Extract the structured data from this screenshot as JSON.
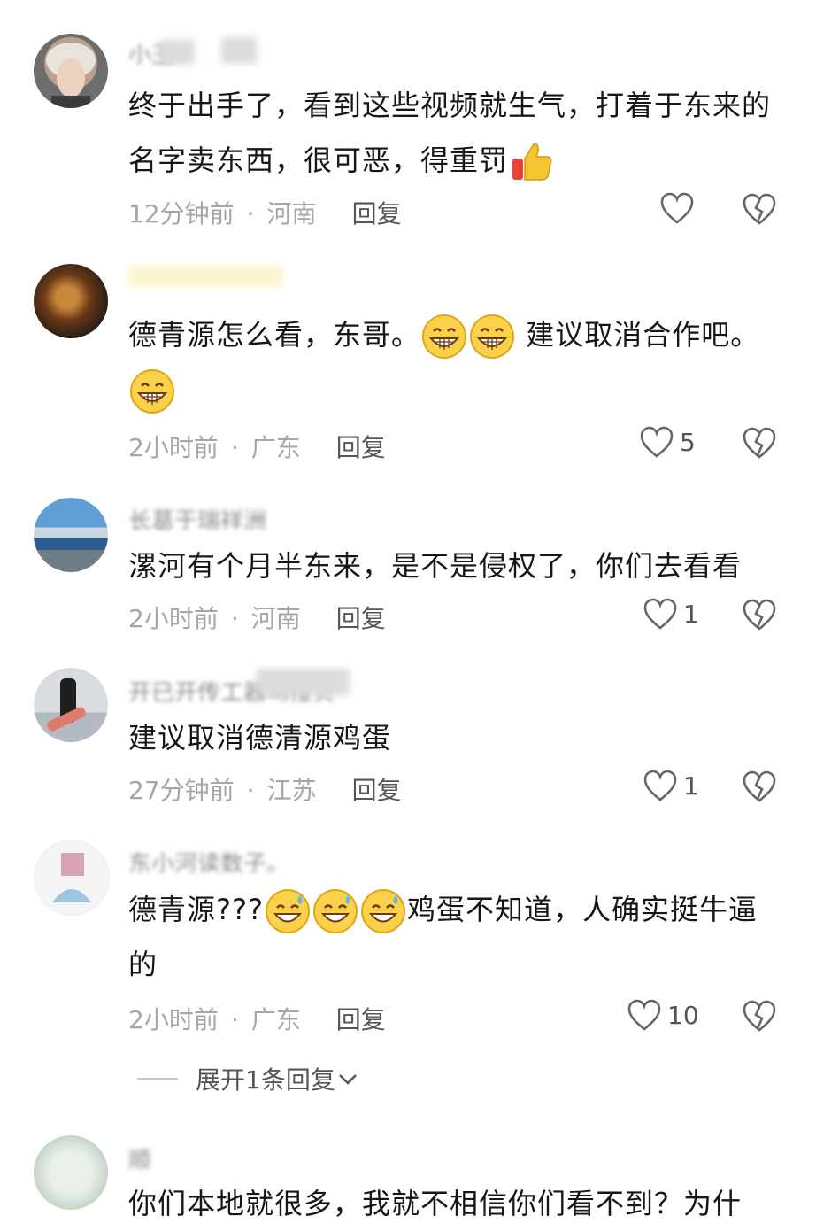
{
  "comments": [
    {
      "username": "小王",
      "text": "终于出手了，看到这些视频就生气，打着于东来的名字卖东西，很可恶，得重罚",
      "emoji_after": "thumbs-up",
      "time": "12分钟前",
      "location": "河南",
      "reply": "回复",
      "likes": ""
    },
    {
      "username": "",
      "text_a": "德青源怎么看，东哥。",
      "text_b": "建议取消合作吧。",
      "time": "2小时前",
      "location": "广东",
      "reply": "回复",
      "likes": "5"
    },
    {
      "username": "长葛于瑞祥洲",
      "text": "漯河有个月半东来，是不是侵权了，你们去看看",
      "time": "2小时前",
      "location": "河南",
      "reply": "回复",
      "likes": "1"
    },
    {
      "username": "开已开传工器马搜贝",
      "text": "建议取消德清源鸡蛋",
      "time": "27分钟前",
      "location": "江苏",
      "reply": "回复",
      "likes": "1"
    },
    {
      "username": "东小河读数子。",
      "text_a": "德青源???",
      "text_b": "鸡蛋不知道，人确实挺牛逼的",
      "time": "2小时前",
      "location": "广东",
      "reply": "回复",
      "likes": "10",
      "expand": "展开1条回复"
    },
    {
      "username": "顺",
      "text": "你们本地就很多，我就不相信你们看不到？为什",
      "time": "",
      "location": "",
      "reply": "",
      "likes": ""
    }
  ],
  "icons": {
    "like": "heart-outline-icon",
    "dislike": "broken-heart-icon",
    "grin": "grin-emoji",
    "sweat": "grin-sweat-emoji",
    "thumb": "thumbs-up-emoji",
    "chevron": "chevron-down-icon"
  }
}
